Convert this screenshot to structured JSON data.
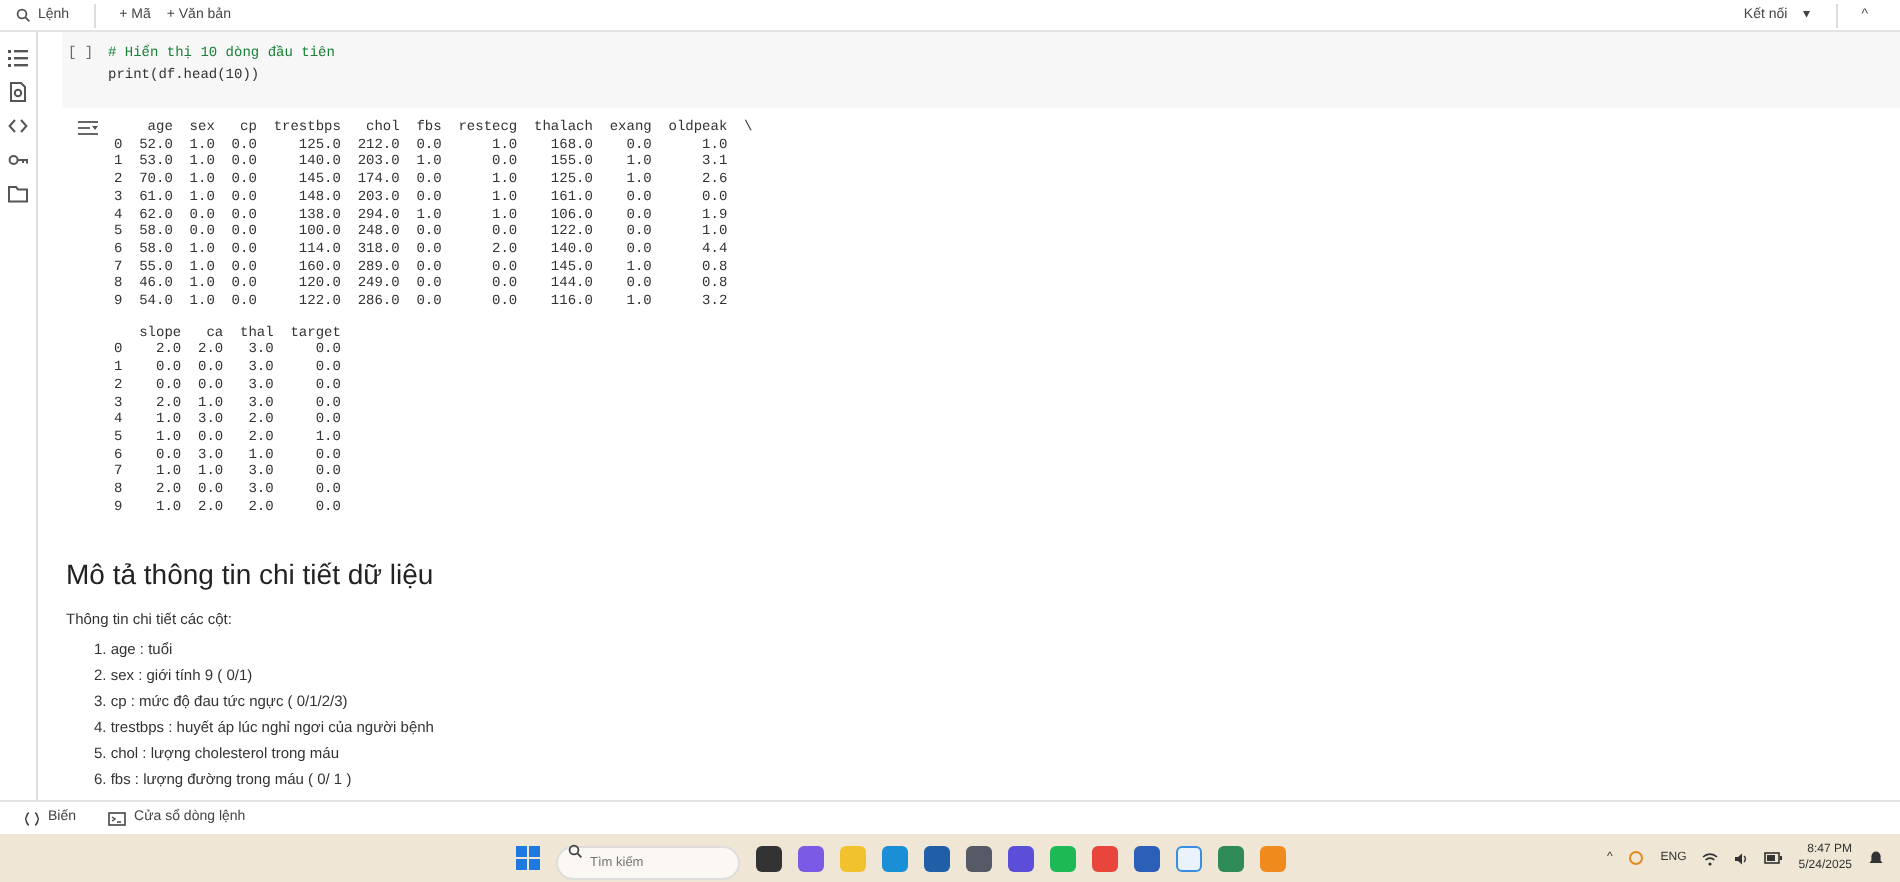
{
  "toolbar": {
    "search": "Lệnh",
    "buttons": [
      "+ Mã",
      "+ Văn bản"
    ],
    "connect": "Kết nối",
    "connect_caret": "▾",
    "collapse": "^"
  },
  "code_cell": {
    "run_label": "[ ]",
    "lines": [
      {
        "kind": "comment",
        "text": "# Hiển thị 10 dòng đầu tiên"
      },
      {
        "kind": "code",
        "text": "print(df.head(10))"
      }
    ]
  },
  "output": {
    "tables": [
      {
        "lines": [
          "    age  sex   cp  trestbps   chol  fbs  restecg  thalach  exang  oldpeak  \\",
          "0  52.0  1.0  0.0     125.0  212.0  0.0      1.0    168.0    0.0      1.0",
          "1  53.0  1.0  0.0     140.0  203.0  1.0      0.0    155.0    1.0      3.1",
          "2  70.0  1.0  0.0     145.0  174.0  0.0      1.0    125.0    1.0      2.6",
          "3  61.0  1.0  0.0     148.0  203.0  0.0      1.0    161.0    0.0      0.0",
          "4  62.0  0.0  0.0     138.0  294.0  1.0      1.0    106.0    0.0      1.9",
          "5  58.0  0.0  0.0     100.0  248.0  0.0      0.0    122.0    0.0      1.0",
          "6  58.0  1.0  0.0     114.0  318.0  0.0      2.0    140.0    0.0      4.4",
          "7  55.0  1.0  0.0     160.0  289.0  0.0      0.0    145.0    1.0      0.8",
          "8  46.0  1.0  0.0     120.0  249.0  0.0      0.0    144.0    0.0      0.8",
          "9  54.0  1.0  0.0     122.0  286.0  0.0      0.0    116.0    1.0      3.2"
        ]
      },
      {
        "lines": [
          "   slope   ca  thal  target",
          "0    2.0  2.0   3.0     0.0",
          "1    0.0  0.0   3.0     0.0",
          "2    0.0  0.0   3.0     0.0",
          "3    2.0  1.0   3.0     0.0",
          "4    1.0  3.0   2.0     0.0",
          "5    1.0  0.0   2.0     1.0",
          "6    0.0  3.0   1.0     0.0",
          "7    1.0  1.0   3.0     0.0",
          "8    2.0  0.0   3.0     0.0",
          "9    1.0  2.0   2.0     0.0"
        ]
      }
    ]
  },
  "markdown": {
    "heading": "Mô tả thông tin chi tiết dữ liệu",
    "intro": "Thông tin chi tiết các cột:",
    "items": [
      {
        "number": "1.",
        "text": "age : tuổi"
      },
      {
        "number": "2.",
        "text": "sex : giới tính 9 ( 0/1)"
      },
      {
        "number": "3.",
        "text": "cp : mức độ đau tức ngực ( 0/1/2/3)"
      },
      {
        "number": "4.",
        "text": "trestbps : huyết áp lúc nghỉ ngơi của người bệnh"
      },
      {
        "number": "5.",
        "text": "chol : lượng cholesterol trong máu"
      },
      {
        "number": "6.",
        "text": "fbs : lượng đường trong máu ( 0/ 1 )"
      }
    ]
  },
  "bottom_bar": [
    "Biến",
    "Cửa sổ dòng lệnh"
  ],
  "taskbar": {
    "search_placeholder": "Tìm kiếm",
    "tray": {
      "chevron": "^",
      "language": "ENG",
      "time": "8:47 PM",
      "date": "5/24/2025"
    }
  }
}
